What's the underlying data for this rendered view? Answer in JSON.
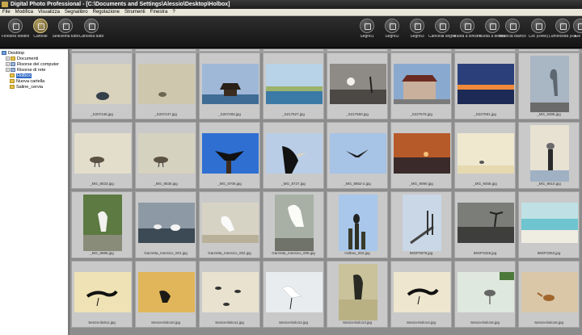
{
  "window": {
    "title": "Digital Photo Professional - [C:\\Documents and Settings\\Alessio\\Desktop\\Holbox]"
  },
  "menu": [
    "File",
    "Modifica",
    "Visualizza",
    "Segnalibro",
    "Regolazione",
    "Strumenti",
    "Finestra",
    "?"
  ],
  "toolbar": {
    "left": [
      {
        "label": "Finestra Modifica",
        "icon": "edit-window-icon",
        "active": false
      },
      {
        "label": "Cartelle",
        "icon": "folders-icon",
        "active": true
      },
      {
        "label": "Seleziona tutto",
        "icon": "select-all-icon",
        "active": false
      },
      {
        "label": "Cancella tutto",
        "icon": "clear-all-icon",
        "active": false
      }
    ],
    "right": [
      {
        "label": "Segno1",
        "icon": "mark1-icon"
      },
      {
        "label": "Segno2",
        "icon": "mark2-icon"
      },
      {
        "label": "Segno3",
        "icon": "mark3-icon"
      },
      {
        "label": "Cancella segno",
        "icon": "clear-mark-icon"
      },
      {
        "label": "Ruota a sinistra",
        "icon": "rotate-left-icon"
      },
      {
        "label": "Ruota a destra",
        "icon": "rotate-right-icon"
      },
      {
        "label": "Bilancia bianco",
        "icon": "white-balance-icon"
      },
      {
        "label": "Clic (RAW)",
        "icon": "click-raw-icon"
      },
      {
        "label": "Luminosità (RAW)",
        "icon": "brightness-raw-icon"
      },
      {
        "label": "Ele",
        "icon": "extra-icon"
      }
    ]
  },
  "tree": [
    {
      "label": "Desktop",
      "icon": "desk",
      "expand": "",
      "selected": false
    },
    {
      "label": "Documenti",
      "icon": "folder",
      "expand": "+",
      "selected": false
    },
    {
      "label": "Risorse del computer",
      "icon": "pc",
      "expand": "+",
      "selected": false
    },
    {
      "label": "Risorse di rete",
      "icon": "pc",
      "expand": "+",
      "selected": false
    },
    {
      "label": "Holbox",
      "icon": "folder",
      "expand": "",
      "selected": true
    },
    {
      "label": "Nuova cartella",
      "icon": "folder",
      "expand": "",
      "selected": false
    },
    {
      "label": "Saline_cervia",
      "icon": "folder",
      "expand": "",
      "selected": false
    }
  ],
  "grid": {
    "rows": [
      [
        {
          "name": "_S207446.jpg",
          "bg": "#d9d2bd",
          "art": "shell"
        },
        {
          "name": "_S207447.jpg",
          "bg": "#cfc7ad",
          "art": "shell2"
        },
        {
          "name": "_S207483.jpg",
          "bg": "#9fb8d8",
          "art": "hut"
        },
        {
          "name": "_S217527.jpg",
          "bg": "#b8d3e8",
          "art": "lagoon"
        },
        {
          "name": "_S217550.jpg",
          "bg": "#8e8a86",
          "art": "sunbw"
        },
        {
          "name": "_S227576.jpg",
          "bg": "#8aa9cf",
          "art": "house"
        },
        {
          "name": "_S227591.jpg",
          "bg": "#2b3f7a",
          "art": "sunset"
        },
        {
          "name": "_MG_8395.jpg",
          "bg": "#a9b6c4",
          "art": "heron",
          "portrait": true
        }
      ],
      [
        {
          "name": "_MG_8633.jpg",
          "bg": "#e3ddcc",
          "art": "sandpiper"
        },
        {
          "name": "_MG_8635.jpg",
          "bg": "#d6d2c0",
          "art": "sandpiper"
        },
        {
          "name": "_MG_8706.jpg",
          "bg": "#2f6fd2",
          "art": "frigate"
        },
        {
          "name": "_MG_8727.jpg",
          "bg": "#b9cee6",
          "art": "frigate2"
        },
        {
          "name": "_MG_8852-2.jpg",
          "bg": "#a7c3e6",
          "art": "flying"
        },
        {
          "name": "_MG_9090.jpg",
          "bg": "#b75a2a",
          "art": "dusk"
        },
        {
          "name": "_MG_9456.jpg",
          "bg": "#efe8cf",
          "art": "tinybird"
        },
        {
          "name": "_MG_9610.jpg",
          "bg": "#e7e2d2",
          "art": "post",
          "portrait": true
        }
      ],
      [
        {
          "name": "_MG_9685.jpg",
          "bg": "#6b8a4f",
          "art": "egrettree",
          "portrait": true
        },
        {
          "name": "Garzetta_messico_001.jpg",
          "bg": "#8d9aa5",
          "art": "ducks"
        },
        {
          "name": "Garzetta_messico_002.jpg",
          "bg": "#d7d3c4",
          "art": "egret"
        },
        {
          "name": "Garzetta_messico_005.jpg",
          "bg": "#a8b0a6",
          "art": "egret2",
          "portrait": true
        },
        {
          "name": "Holbox_002.jpg",
          "bg": "#a8c7ea",
          "art": "posts",
          "portrait": true
        },
        {
          "name": "IMGP3979.jpg",
          "bg": "#c9d7e6",
          "art": "pier",
          "portrait": true
        },
        {
          "name": "IMGP3348.jpg",
          "bg": "#7b7d79",
          "art": "palm"
        },
        {
          "name": "IMGP3353.jpg",
          "bg": "#bfe0e4",
          "art": "sea"
        }
      ],
      [
        {
          "name": "Senza-titolo1.jpg",
          "bg": "#efe2b5",
          "art": "ibis"
        },
        {
          "name": "Senza-titolo10.jpg",
          "bg": "#e1b65a",
          "art": "ibis2"
        },
        {
          "name": "Senza-titolo11.jpg",
          "bg": "#e8e2cf",
          "art": "flock"
        },
        {
          "name": "Senza-titolo12.jpg",
          "bg": "#e9ecee",
          "art": "egret3"
        },
        {
          "name": "Senza-titolo13.jpg",
          "bg": "#c9c29a",
          "art": "darkbird",
          "portrait": true
        },
        {
          "name": "Senza-titolo14.jpg",
          "bg": "#efe6cf",
          "art": "ibis3"
        },
        {
          "name": "Senza-titolo15.jpg",
          "bg": "#dfe8de",
          "art": "wader"
        },
        {
          "name": "Senza-titolo16.jpg",
          "bg": "#d9c7a8",
          "art": "crab"
        }
      ]
    ],
    "top_partial": [
      "",
      "",
      "",
      "",
      "",
      "",
      "",
      ""
    ]
  }
}
